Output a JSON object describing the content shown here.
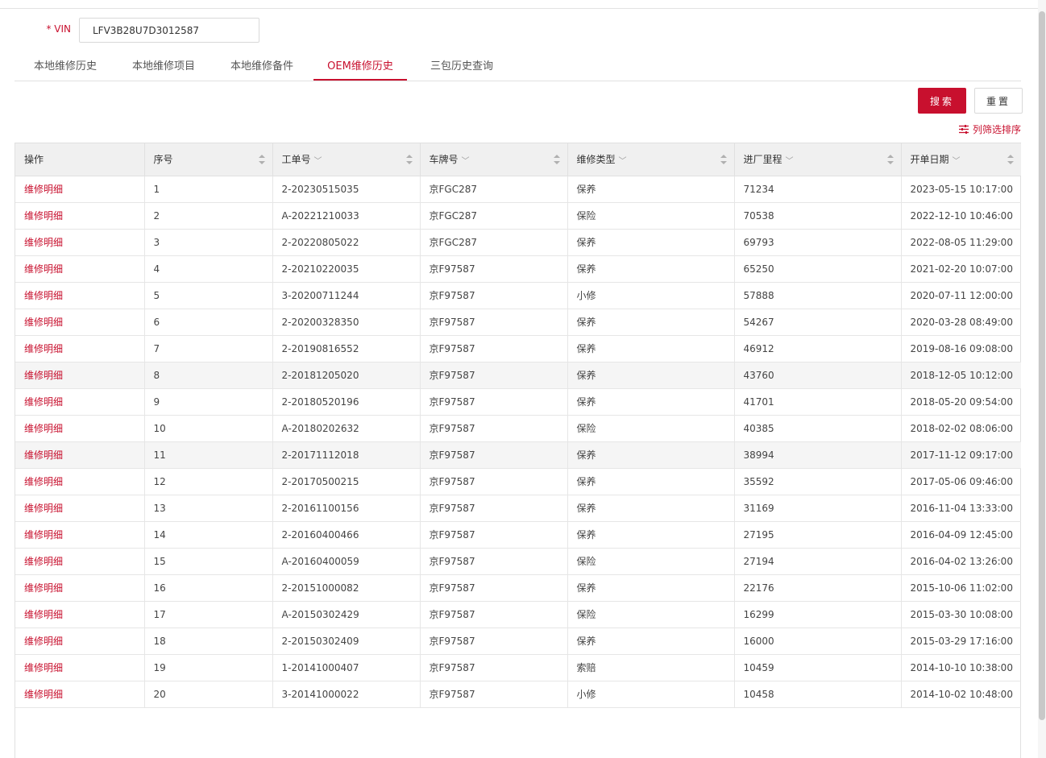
{
  "vin": {
    "required_mark": "* VIN",
    "value": "LFV3B28U7D3012587"
  },
  "tabs": [
    {
      "label": "本地维修历史",
      "active": false
    },
    {
      "label": "本地维修项目",
      "active": false
    },
    {
      "label": "本地维修备件",
      "active": false
    },
    {
      "label": "OEM维修历史",
      "active": true
    },
    {
      "label": "三包历史查询",
      "active": false
    }
  ],
  "buttons": {
    "search": "搜索",
    "reset": "重置"
  },
  "column_sort_label": "列筛选排序",
  "colors": {
    "accent": "#c8102e",
    "header_bg": "#f0f0f0",
    "highlight_row": "#f5f5f5"
  },
  "table": {
    "headers": [
      "操作",
      "序号",
      "工单号",
      "车牌号",
      "维修类型",
      "进厂里程",
      "开单日期"
    ],
    "rows": [
      [
        "维修明细",
        "1",
        "2-20230515035",
        "京FGC287",
        "保养",
        "71234",
        "2023-05-15 10:17:00"
      ],
      [
        "维修明细",
        "2",
        "A-20221210033",
        "京FGC287",
        "保险",
        "70538",
        "2022-12-10 10:46:00"
      ],
      [
        "维修明细",
        "3",
        "2-20220805022",
        "京FGC287",
        "保养",
        "69793",
        "2022-08-05 11:29:00"
      ],
      [
        "维修明细",
        "4",
        "2-20210220035",
        "京F97587",
        "保养",
        "65250",
        "2021-02-20 10:07:00"
      ],
      [
        "维修明细",
        "5",
        "3-20200711244",
        "京F97587",
        "小修",
        "57888",
        "2020-07-11 12:00:00"
      ],
      [
        "维修明细",
        "6",
        "2-20200328350",
        "京F97587",
        "保养",
        "54267",
        "2020-03-28 08:49:00"
      ],
      [
        "维修明细",
        "7",
        "2-20190816552",
        "京F97587",
        "保养",
        "46912",
        "2019-08-16 09:08:00"
      ],
      [
        "维修明细",
        "8",
        "2-20181205020",
        "京F97587",
        "保养",
        "43760",
        "2018-12-05 10:12:00"
      ],
      [
        "维修明细",
        "9",
        "2-20180520196",
        "京F97587",
        "保养",
        "41701",
        "2018-05-20 09:54:00"
      ],
      [
        "维修明细",
        "10",
        "A-20180202632",
        "京F97587",
        "保险",
        "40385",
        "2018-02-02 08:06:00"
      ],
      [
        "维修明细",
        "11",
        "2-20171112018",
        "京F97587",
        "保养",
        "38994",
        "2017-11-12 09:17:00"
      ],
      [
        "维修明细",
        "12",
        "2-20170500215",
        "京F97587",
        "保养",
        "35592",
        "2017-05-06 09:46:00"
      ],
      [
        "维修明细",
        "13",
        "2-20161100156",
        "京F97587",
        "保养",
        "31169",
        "2016-11-04 13:33:00"
      ],
      [
        "维修明细",
        "14",
        "2-20160400466",
        "京F97587",
        "保养",
        "27195",
        "2016-04-09 12:45:00"
      ],
      [
        "维修明细",
        "15",
        "A-20160400059",
        "京F97587",
        "保险",
        "27194",
        "2016-04-02 13:26:00"
      ],
      [
        "维修明细",
        "16",
        "2-20151000082",
        "京F97587",
        "保养",
        "22176",
        "2015-10-06 11:02:00"
      ],
      [
        "维修明细",
        "17",
        "A-20150302429",
        "京F97587",
        "保险",
        "16299",
        "2015-03-30 10:08:00"
      ],
      [
        "维修明细",
        "18",
        "2-20150302409",
        "京F97587",
        "保养",
        "16000",
        "2015-03-29 17:16:00"
      ],
      [
        "维修明细",
        "19",
        "1-20141000407",
        "京F97587",
        "索赔",
        "10459",
        "2014-10-10 10:38:00"
      ],
      [
        "维修明细",
        "20",
        "3-20141000022",
        "京F97587",
        "小修",
        "10458",
        "2014-10-02 10:48:00"
      ]
    ],
    "highlighted_rows": [
      8,
      11
    ]
  }
}
